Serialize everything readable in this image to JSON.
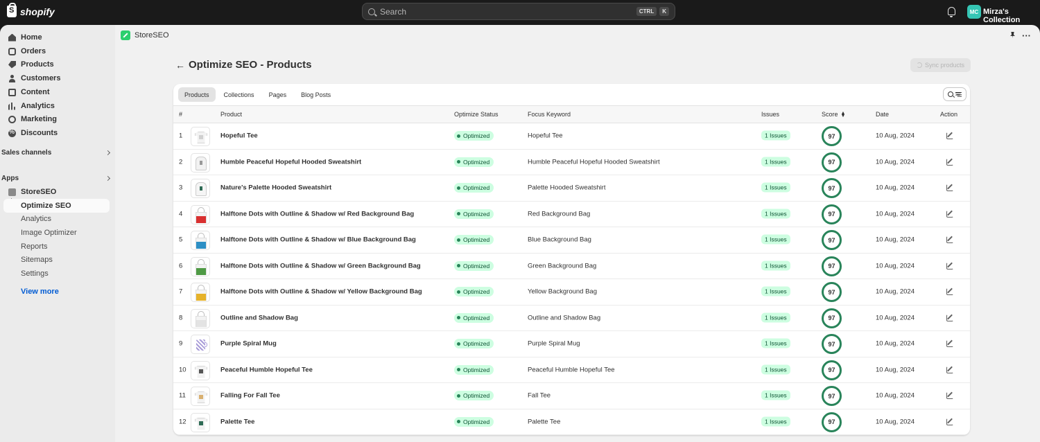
{
  "topbar": {
    "brand": "shopify",
    "search_placeholder": "Search",
    "shortcut_ctrl": "CTRL",
    "shortcut_key": "K",
    "avatar_initials": "MC",
    "store_name": "Mirza's Collection"
  },
  "sidebar": {
    "items": [
      {
        "label": "Home",
        "icon": "home-icon"
      },
      {
        "label": "Orders",
        "icon": "orders-icon"
      },
      {
        "label": "Products",
        "icon": "tag-icon"
      },
      {
        "label": "Customers",
        "icon": "person-icon"
      },
      {
        "label": "Content",
        "icon": "content-icon"
      },
      {
        "label": "Analytics",
        "icon": "analytics-icon"
      },
      {
        "label": "Marketing",
        "icon": "marketing-icon"
      },
      {
        "label": "Discounts",
        "icon": "discount-icon"
      }
    ],
    "sales_channels": "Sales channels",
    "apps": "Apps",
    "app_name": "StoreSEO",
    "sub_items": [
      "Optimize SEO",
      "Analytics",
      "Image Optimizer",
      "Reports",
      "Sitemaps",
      "Settings"
    ],
    "view_more": "View more"
  },
  "app_header": {
    "title": "StoreSEO"
  },
  "page": {
    "title": "Optimize SEO - Products",
    "sync_button": "Sync products",
    "tabs": [
      "Products",
      "Collections",
      "Pages",
      "Blog Posts"
    ]
  },
  "table": {
    "headers": {
      "num": "#",
      "product": "Product",
      "status": "Optimize Status",
      "keyword": "Focus Keyword",
      "issues": "Issues",
      "score": "Score",
      "date": "Date",
      "action": "Action"
    },
    "rows": [
      {
        "num": "1",
        "product": "Hopeful Tee",
        "status": "Optimized",
        "keyword": "Hopeful Tee",
        "issues": "1 Issues",
        "score": "97",
        "date": "10 Aug, 2024"
      },
      {
        "num": "2",
        "product": "Humble Peaceful Hopeful Hooded Sweatshirt",
        "status": "Optimized",
        "keyword": "Humble Peaceful Hopeful Hooded Sweatshirt",
        "issues": "1 Issues",
        "score": "97",
        "date": "10 Aug, 2024"
      },
      {
        "num": "3",
        "product": "Nature's Palette Hooded Sweatshirt",
        "status": "Optimized",
        "keyword": "Palette Hooded Sweatshirt",
        "issues": "1 Issues",
        "score": "97",
        "date": "10 Aug, 2024"
      },
      {
        "num": "4",
        "product": "Halftone Dots with Outline & Shadow w/ Red Background Bag",
        "status": "Optimized",
        "keyword": "Red Background Bag",
        "issues": "1 Issues",
        "score": "97",
        "date": "10 Aug, 2024"
      },
      {
        "num": "5",
        "product": "Halftone Dots with Outline & Shadow w/ Blue Background Bag",
        "status": "Optimized",
        "keyword": "Blue Background Bag",
        "issues": "1 Issues",
        "score": "97",
        "date": "10 Aug, 2024"
      },
      {
        "num": "6",
        "product": "Halftone Dots with Outline & Shadow w/ Green Background Bag",
        "status": "Optimized",
        "keyword": "Green Background Bag",
        "issues": "1 Issues",
        "score": "97",
        "date": "10 Aug, 2024"
      },
      {
        "num": "7",
        "product": "Halftone Dots with Outline & Shadow w/ Yellow Background Bag",
        "status": "Optimized",
        "keyword": "Yellow Background Bag",
        "issues": "1 Issues",
        "score": "97",
        "date": "10 Aug, 2024"
      },
      {
        "num": "8",
        "product": "Outline and Shadow Bag",
        "status": "Optimized",
        "keyword": "Outline and Shadow Bag",
        "issues": "1 Issues",
        "score": "97",
        "date": "10 Aug, 2024"
      },
      {
        "num": "9",
        "product": "Purple Spiral Mug",
        "status": "Optimized",
        "keyword": "Purple Spiral Mug",
        "issues": "1 Issues",
        "score": "97",
        "date": "10 Aug, 2024"
      },
      {
        "num": "10",
        "product": "Peaceful Humble Hopeful Tee",
        "status": "Optimized",
        "keyword": "Peaceful Humble Hopeful Tee",
        "issues": "1 Issues",
        "score": "97",
        "date": "10 Aug, 2024"
      },
      {
        "num": "11",
        "product": "Falling For Fall Tee",
        "status": "Optimized",
        "keyword": "Fall Tee",
        "issues": "1 Issues",
        "score": "97",
        "date": "10 Aug, 2024"
      },
      {
        "num": "12",
        "product": "Palette Tee",
        "status": "Optimized",
        "keyword": "Palette Tee",
        "issues": "1 Issues",
        "score": "97",
        "date": "10 Aug, 2024"
      }
    ]
  },
  "colors": {
    "topbar": "#1a1a1a",
    "accent_green": "#29845a",
    "badge_green_bg": "#cdfee1",
    "link_blue": "#005bd3",
    "app_logo": "#2dcf6e"
  }
}
